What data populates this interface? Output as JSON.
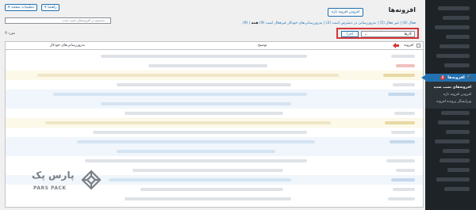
{
  "sidebar": {
    "active_label": "افزونه‌ها",
    "active_badge": "2",
    "submenu": [
      "افزونه‌های نصب شده",
      "افزودن افزونه تازه",
      "ویرایشگر پرونده افزونه"
    ]
  },
  "toolbar": {
    "screen_options_label": "تنظیمات صفحه",
    "help_label": "راهنما"
  },
  "header": {
    "title": "افزونه‌ها",
    "add_new_label": "افزودن افزونه تازه"
  },
  "views": {
    "text_prefix": "همه",
    "text": "(9) | فعال (4) | غیر فعال (5) | به‌روزرسانی در دسترس است (2) | به‌روزرسانی‌های خودکار غیرفعال است (9)"
  },
  "search": {
    "placeholder": "جستجو در افزونه‌های نصب شده..."
  },
  "bulk": {
    "selected": "کار‌ها",
    "apply_label": "اجرا"
  },
  "items_count": "9 مورد",
  "table": {
    "col_plugin": "افزونه",
    "col_description": "توضیح",
    "col_autoupdate": "به‌روزرسانی‌های خودکار"
  },
  "brand": {
    "logo_text_fa": "پارس پک",
    "logo_text_en": "PARS PACK"
  },
  "colors": {
    "highlight": "#d63638",
    "accent": "#2271b1",
    "sidebar": "#1d2327"
  }
}
